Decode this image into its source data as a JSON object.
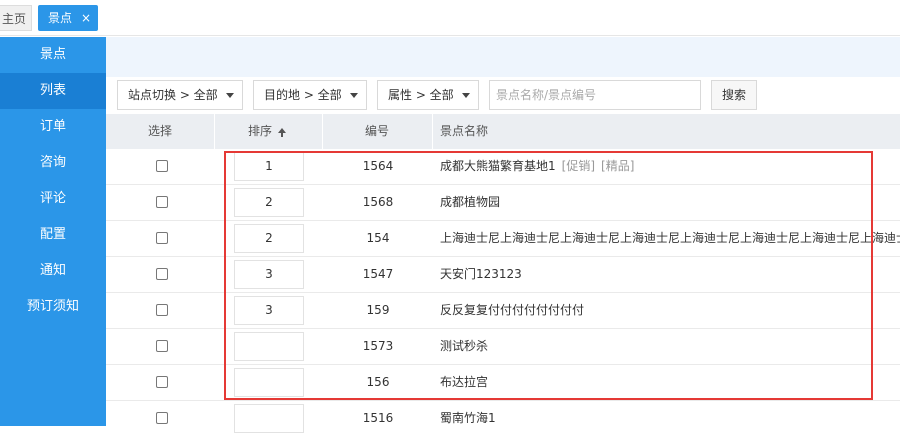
{
  "tabs": {
    "home_label": "主页",
    "active_label": "景点",
    "close_glyph": "×"
  },
  "sidebar": {
    "items": [
      {
        "label": "景点"
      },
      {
        "label": "列表"
      },
      {
        "label": "订单"
      },
      {
        "label": "咨询"
      },
      {
        "label": "评论"
      },
      {
        "label": "配置"
      },
      {
        "label": "通知"
      },
      {
        "label": "预订须知"
      }
    ],
    "active_index": 1
  },
  "filters": {
    "station": "站点切换 > 全部",
    "destination": "目的地 > 全部",
    "attribute": "属性 > 全部",
    "search_placeholder": "景点名称/景点编号",
    "search_button": "搜索"
  },
  "table": {
    "headers": {
      "select": "选择",
      "sort": "排序",
      "number": "编号",
      "name": "景点名称"
    },
    "rows": [
      {
        "sort": "1",
        "number": "1564",
        "name": "成都大熊猫繁育基地1",
        "tags": [
          "[促销]",
          "[精品]"
        ]
      },
      {
        "sort": "2",
        "number": "1568",
        "name": "成都植物园",
        "tags": []
      },
      {
        "sort": "2",
        "number": "154",
        "name": "上海迪士尼上海迪士尼上海迪士尼上海迪士尼上海迪士尼上海迪士尼上海迪士尼上海迪士",
        "tags": []
      },
      {
        "sort": "3",
        "number": "1547",
        "name": "天安门123123",
        "tags": []
      },
      {
        "sort": "3",
        "number": "159",
        "name": "反反复复付付付付付付付付",
        "tags": []
      },
      {
        "sort": "",
        "number": "1573",
        "name": "测试秒杀",
        "tags": []
      },
      {
        "sort": "",
        "number": "156",
        "name": "布达拉宫",
        "tags": []
      },
      {
        "sort": "",
        "number": "1516",
        "name": "蜀南竹海1",
        "tags": []
      }
    ]
  },
  "colors": {
    "sidebar": "#2b96e8",
    "sidebar_active": "#1a7fd4",
    "highlight_box": "#e53935"
  }
}
